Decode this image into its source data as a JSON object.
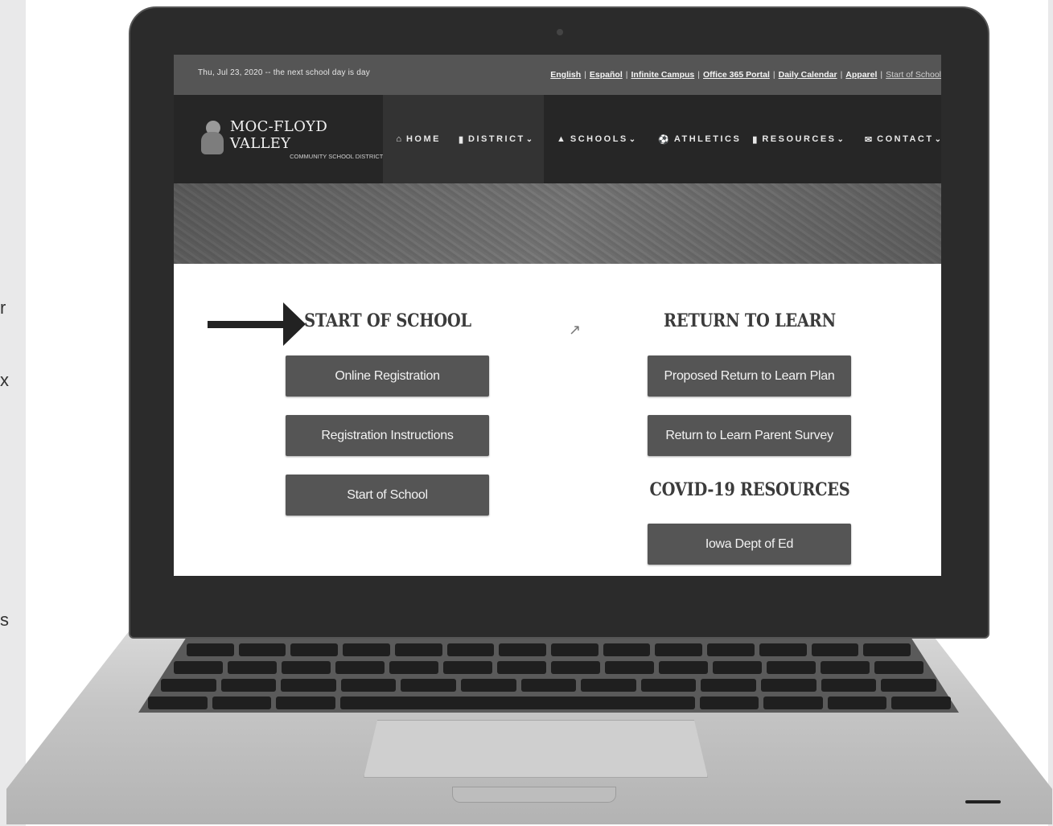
{
  "edge_chars": [
    "r",
    "x",
    "s"
  ],
  "topbar": {
    "date_text": "Thu, Jul 23, 2020 -- the next school day is day",
    "links": [
      "English",
      "Español",
      "Infinite Campus",
      "Office 365 Portal",
      "Daily Calendar",
      "Apparel",
      "Start of School"
    ]
  },
  "logo": {
    "title": "MOC-FLOYD VALLEY",
    "subtitle": "COMMUNITY SCHOOL DISTRICT"
  },
  "nav": {
    "home": "HOME",
    "district": "DISTRICT",
    "schools": "SCHOOLS",
    "athletics": "ATHLETICS",
    "resources": "RESOURCES",
    "contact": "CONTACT"
  },
  "start_of_school": {
    "heading": "START OF SCHOOL",
    "buttons": [
      "Online Registration",
      "Registration Instructions",
      "Start of School"
    ]
  },
  "return_to_learn": {
    "heading": "RETURN TO LEARN",
    "buttons": [
      "Proposed Return to Learn Plan",
      "Return to Learn Parent Survey"
    ]
  },
  "covid": {
    "heading": "COVID-19 RESOURCES",
    "buttons": [
      "Iowa Dept of Ed"
    ]
  },
  "icons": [
    "home-icon",
    "building-icon",
    "graduation-cap-icon",
    "soccer-ball-icon",
    "book-icon",
    "envelope-icon",
    "chevron-down-icon",
    "arrow-icon",
    "mouse-cursor-icon"
  ]
}
